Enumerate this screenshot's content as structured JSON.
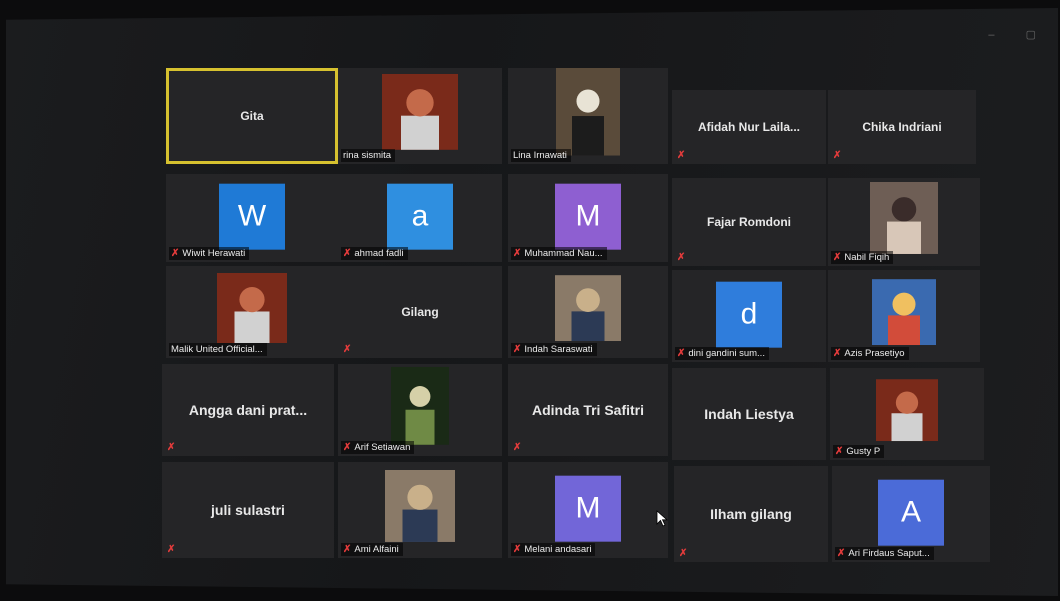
{
  "participants": [
    {
      "name": "Gita",
      "display": "name",
      "muted": false,
      "active": true
    },
    {
      "name": "rina sismita",
      "display": "photo",
      "muted": false
    },
    {
      "name": "Lina Irnawati",
      "display": "photo",
      "muted": false
    },
    {
      "name": "Afidah Nur Laila...",
      "display": "name",
      "muted": true
    },
    {
      "name": "Chika Indriani",
      "display": "name",
      "muted": true
    },
    {
      "name": "Wiwit Herawati",
      "display": "avatar",
      "initial": "W",
      "avatar_color": "#1f7ad6",
      "muted": true
    },
    {
      "name": "ahmad fadli",
      "display": "avatar",
      "initial": "a",
      "avatar_color": "#2f8fe0",
      "muted": true
    },
    {
      "name": "Muhammad Nau...",
      "display": "avatar",
      "initial": "M",
      "avatar_color": "#8e5fd1",
      "muted": true
    },
    {
      "name": "Fajar Romdoni",
      "display": "name",
      "muted": true
    },
    {
      "name": "Nabil Fiqih",
      "display": "photo",
      "muted": true
    },
    {
      "name": "Malik United Official...",
      "display": "photo",
      "muted": false
    },
    {
      "name": "Gilang",
      "display": "name",
      "muted": true
    },
    {
      "name": "Indah Saraswati",
      "display": "photo",
      "muted": true
    },
    {
      "name": "dini gandini sum...",
      "display": "avatar",
      "initial": "d",
      "avatar_color": "#2f7ddc",
      "muted": true
    },
    {
      "name": "Azis Prasetiyo",
      "display": "photo",
      "muted": true
    },
    {
      "name": "Angga dani prat...",
      "display": "name",
      "muted": true
    },
    {
      "name": "Arif Setiawan",
      "display": "photo",
      "muted": true
    },
    {
      "name": "Adinda Tri Safitri",
      "display": "name",
      "muted": true
    },
    {
      "name": "Indah Liestya",
      "display": "name",
      "muted": false
    },
    {
      "name": "Gusty P",
      "display": "photo",
      "muted": true
    },
    {
      "name": "juli sulastri",
      "display": "name",
      "muted": true
    },
    {
      "name": "Ami Alfaini",
      "display": "photo",
      "muted": true
    },
    {
      "name": "Melani andasari",
      "display": "avatar",
      "initial": "M",
      "avatar_color": "#7266d8",
      "muted": true
    },
    {
      "name": "Ilham gilang",
      "display": "name",
      "muted": true
    },
    {
      "name": "Ari Firdaus Saput...",
      "display": "avatar",
      "initial": "A",
      "avatar_color": "#4b6bd8",
      "muted": true
    }
  ],
  "icons": {
    "muted": "microphone-muted-icon",
    "cursor": "mouse-cursor-icon"
  },
  "colors": {
    "active_border": "#d6c12f",
    "tile_bg": "#252527",
    "muted_red": "#e23b3b"
  }
}
